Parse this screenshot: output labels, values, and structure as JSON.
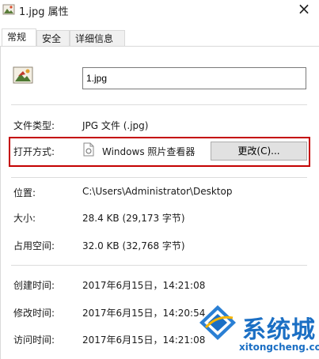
{
  "window": {
    "title": "1.jpg 属性",
    "close_glyph": "×"
  },
  "tabs": [
    {
      "label": "常规",
      "active": true
    },
    {
      "label": "安全",
      "active": false
    },
    {
      "label": "详细信息",
      "active": false
    }
  ],
  "file": {
    "name": "1.jpg"
  },
  "details": {
    "file_type": {
      "label": "文件类型:",
      "value": "JPG 文件 (.jpg)"
    },
    "open_with": {
      "label": "打开方式:",
      "app": "Windows 照片查看器",
      "button": "更改(C)..."
    },
    "location": {
      "label": "位置:",
      "value": "C:\\Users\\Administrator\\Desktop"
    },
    "size": {
      "label": "大小:",
      "value": "28.4 KB (29,173 字节)"
    },
    "size_on_disk": {
      "label": "占用空间:",
      "value": "32.0 KB (32,768 字节)"
    },
    "created": {
      "label": "创建时间:",
      "value": "2017年6月15日，14:21:08"
    },
    "modified": {
      "label": "修改时间:",
      "value": "2017年6月15日，14:20:54"
    },
    "accessed": {
      "label": "访问时间:",
      "value": "2017年6月15日，14:21:08"
    }
  },
  "watermark": {
    "text": "系统城",
    "subtext": "xitongcheng.com"
  },
  "colors": {
    "highlight": "#c40000",
    "watermark": "#1b6fc4"
  },
  "icons": {
    "title": "image-file-icon",
    "file": "image-file-icon",
    "app": "photo-viewer-icon"
  }
}
